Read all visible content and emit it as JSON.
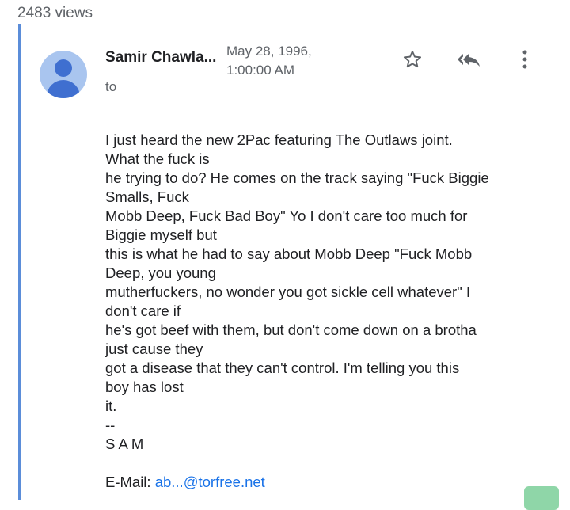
{
  "views": "2483 views",
  "header": {
    "sender": "Samir Chawla...",
    "to_label": "to",
    "date_line1": "May 28, 1996,",
    "date_line2": "1:00:00 AM"
  },
  "icons": {
    "star": "star-icon",
    "reply_all": "reply-all-icon",
    "more": "more-vert-icon"
  },
  "message": {
    "lines": [
      "I just heard the new 2Pac featuring The Outlaws joint.",
      "What the fuck is",
      "he trying to do? He comes on the track saying \"Fuck Biggie",
      "Smalls, Fuck",
      "Mobb Deep, Fuck Bad Boy\" Yo I don't care too much for",
      "Biggie myself but",
      "this is what he had to say about Mobb Deep \"Fuck Mobb",
      "Deep, you young",
      "mutherfuckers, no wonder you got sickle cell whatever\" I",
      "don't care if",
      "he's got beef with them, but don't come down on a brotha",
      "just cause they",
      "got a disease that they can't control. I'm telling you this",
      "boy has lost",
      "it.",
      "--",
      "S A M"
    ],
    "email_label": "E-Mail: ",
    "email_address": "ab...@torfree.net"
  },
  "colors": {
    "accent_line": "#5b8dd9",
    "link": "#1a73e8",
    "avatar_bg": "#a9c5ef",
    "avatar_fg": "#3f6fd0"
  }
}
